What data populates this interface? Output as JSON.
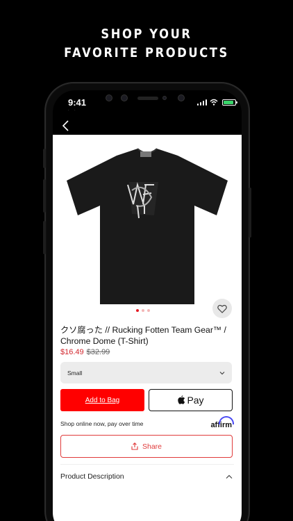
{
  "promo": {
    "line1": "SHOP YOUR",
    "line2": "FAVORITE PRODUCTS"
  },
  "status_bar": {
    "time": "9:41",
    "subtext": "· ·",
    "battery_color": "#3ad66b"
  },
  "nav": {
    "back_icon": "chevron-left-icon"
  },
  "product": {
    "title": "クソ腐った // Rucking Fotten Team Gear™ / Chrome Dome (T-Shirt)",
    "sale_price": "$16.49",
    "original_price": "$32.99",
    "image_dots_active_index": 0,
    "image_dots_count": 3,
    "favorite_icon": "heart-outline-icon"
  },
  "size_select": {
    "value": "Small",
    "icon": "chevron-down-icon"
  },
  "actions": {
    "add_to_bag_label": "Add to Bag",
    "apple_pay_label": "Pay",
    "share_label": "Share",
    "share_icon": "share-upload-icon"
  },
  "affirm": {
    "text": "Shop online now, pay over time",
    "logo_text": "affirm",
    "logo_color": "#4a4af4"
  },
  "description": {
    "label": "Product Description",
    "icon": "chevron-up-icon"
  },
  "colors": {
    "brand_red": "#ff0000",
    "price_red": "#d2272e",
    "dot_active": "#e41b23"
  }
}
